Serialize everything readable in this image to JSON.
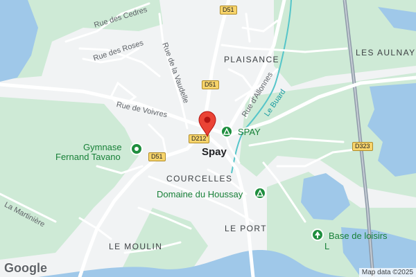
{
  "streets": {
    "rue_des_cedres": "Rue des Cedres",
    "rue_des_roses": "Rue des Roses",
    "rue_de_la_vaudelle": "Rue de la Vaudelle",
    "rue_de_voivres": "Rue de Voivres",
    "rue_dallonnes": "Rue d'Allonnes",
    "la_martiniere": "La Martinière"
  },
  "places": {
    "plaisance": "PLAISANCE",
    "les_aulnay": "LES AULNAY",
    "spay": "Spay",
    "courcelles": "COURCELLES",
    "le_port": "LE PORT",
    "le_moulin": "LE MOULIN"
  },
  "pois": {
    "spay_camping": "SPAY",
    "gymnase_line1": "Gymnase",
    "gymnase_line2": "Fernand Tavano",
    "domaine": "Domaine du Houssay",
    "base_line1": "Base de loisirs",
    "base_line2": "L"
  },
  "river": "Le Buard",
  "roads": {
    "d51_top": "D51",
    "d51_mid": "D51",
    "d51_left": "D51",
    "d212": "D212",
    "d323": "D323"
  },
  "icons": {
    "location_pin": "map-pin-icon",
    "camping": "campground-icon",
    "sports": "sports-center-icon",
    "park": "park-icon"
  },
  "colors": {
    "land": "#f1f3f4",
    "greenery": "#ceead6",
    "water": "#9fc8e9",
    "river_line": "#55c5c9",
    "pin": "#ea4335",
    "poi_green": "#188038"
  },
  "footer": {
    "logo": "Google",
    "attribution": "Map data ©2025"
  }
}
